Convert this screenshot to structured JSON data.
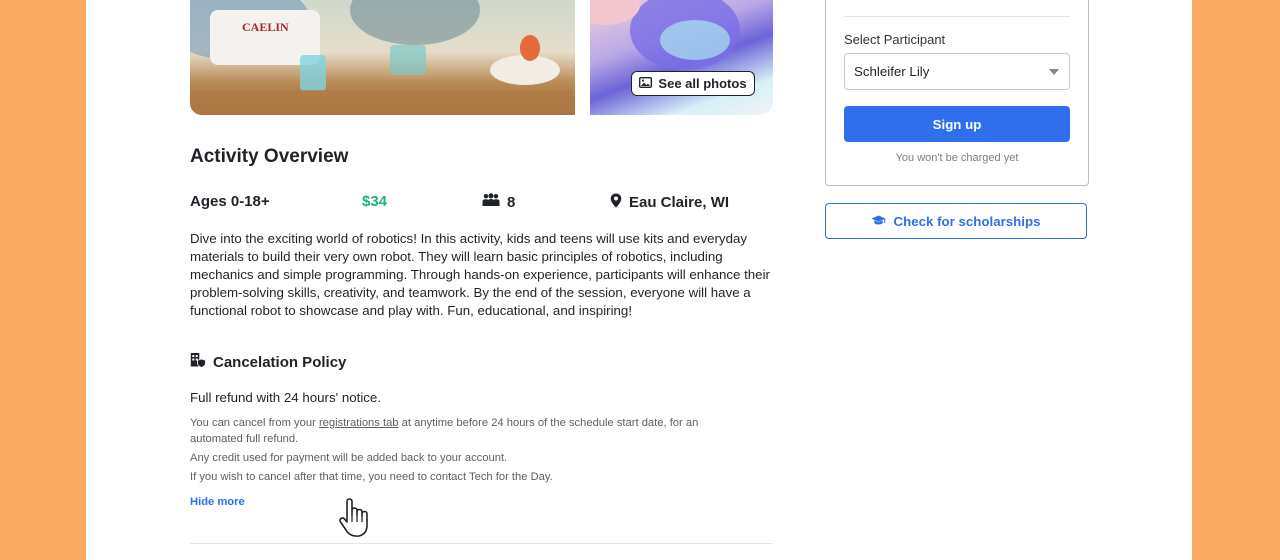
{
  "gallery": {
    "see_all_label": "See all photos",
    "apron_text": "CAELIN"
  },
  "overview": {
    "title": "Activity Overview",
    "ages": "Ages 0-18+",
    "price": "$34",
    "participants": "8",
    "location": "Eau Claire, WI",
    "description": "Dive into the exciting world of robotics! In this activity, kids and teens will use kits and everyday materials to build their very own robot. They will learn basic principles of robotics, including mechanics and simple programming. Through hands-on experience, participants will enhance their problem-solving skills, creativity, and teamwork. By the end of the session, everyone will have a functional robot to showcase and play with. Fun, educational, and inspiring!"
  },
  "policy": {
    "title": "Cancelation Policy",
    "summary": "Full refund with 24 hours' notice.",
    "line1_prefix": "You can cancel from your ",
    "line1_link": "registrations tab",
    "line1_suffix": " at anytime before 24 hours of the schedule start date, for an automated full refund.",
    "line2": "Any credit used for payment will be added back to your account.",
    "line3": "If you wish to cancel after that time, you need to contact Tech for the Day.",
    "toggle_label": "Hide more"
  },
  "booking": {
    "participant_label": "Select Participant",
    "participant_value": "Schleifer Lily",
    "signup_label": "Sign up",
    "charge_note": "You won't be charged yet",
    "scholarship_label": "Check for scholarships"
  },
  "colors": {
    "background": "#fbab64",
    "accent": "#2f6fed",
    "price": "#1db574"
  }
}
